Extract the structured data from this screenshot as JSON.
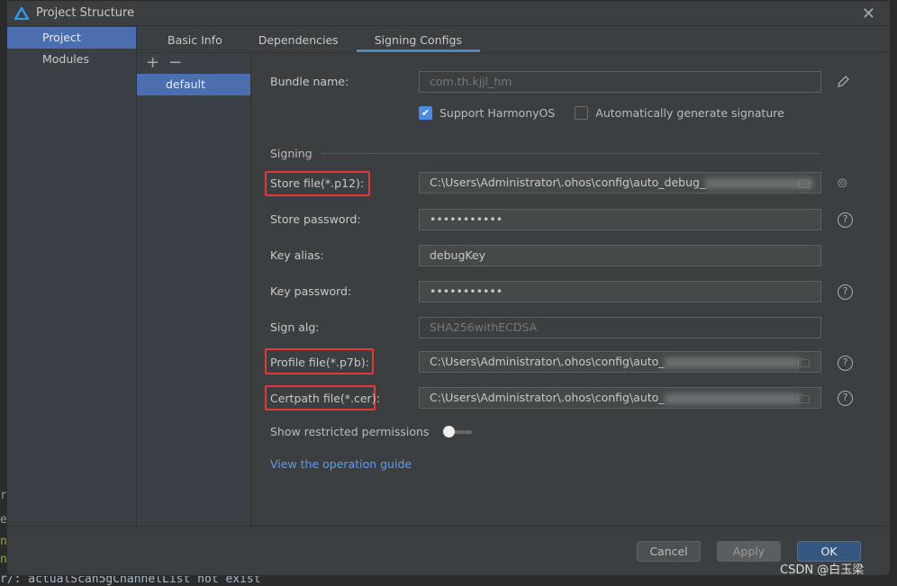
{
  "background_log": {
    "lines": [
      "rs",
      "e",
      "n",
      "n",
      "r/: actualScan5gChannelList not exist"
    ]
  },
  "window": {
    "title": "Project Structure",
    "close_icon": "close-icon"
  },
  "sidebar": {
    "items": [
      {
        "label": "Project",
        "selected": true
      },
      {
        "label": "Modules",
        "selected": false
      }
    ]
  },
  "tabs": [
    {
      "label": "Basic Info"
    },
    {
      "label": "Dependencies"
    },
    {
      "label": "Signing Configs",
      "active": true
    }
  ],
  "config_list": {
    "add": "+",
    "remove": "−",
    "items": [
      "default"
    ]
  },
  "form": {
    "bundle_name": {
      "label": "Bundle name:",
      "value": "com.th.kjjl_hm"
    },
    "support_harmony": {
      "label": "Support HarmonyOS",
      "checked": true
    },
    "auto_sign": {
      "label": "Automatically generate signature",
      "checked": false
    },
    "signing_section": "Signing",
    "store_file": {
      "label": "Store file(*.p12):",
      "value": "C:\\Users\\Administrator\\.ohos\\config\\auto_debug_"
    },
    "store_password": {
      "label": "Store password:",
      "value": "•••••••••••"
    },
    "key_alias": {
      "label": "Key alias:",
      "value": "debugKey"
    },
    "key_password": {
      "label": "Key password:",
      "value": "•••••••••••"
    },
    "sign_alg": {
      "label": "Sign alg:",
      "value": "SHA256withECDSA"
    },
    "profile_file": {
      "label": "Profile file(*.p7b):",
      "value": "C:\\Users\\Administrator\\.ohos\\config\\auto_"
    },
    "certpath_file": {
      "label": "Certpath file(*.cer):",
      "value": "C:\\Users\\Administrator\\.ohos\\config\\auto_"
    },
    "restricted": {
      "label": "Show restricted permissions",
      "on": false
    },
    "guide_link": "View the operation guide"
  },
  "buttons": {
    "cancel": "Cancel",
    "apply": "Apply",
    "ok": "OK"
  },
  "watermark": "CSDN @白玉梁",
  "colors": {
    "accent": "#4b6eaf",
    "highlight": "#e53935",
    "link": "#589df6"
  }
}
